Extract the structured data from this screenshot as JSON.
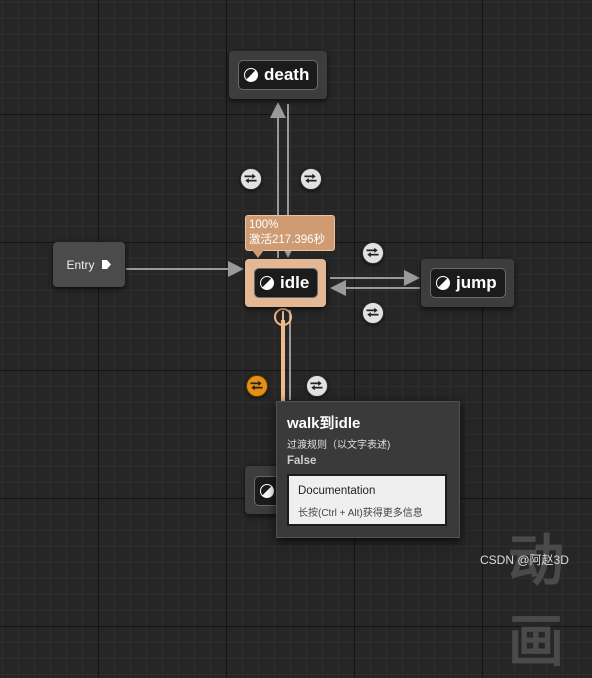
{
  "graph": {
    "entry_label": "Entry",
    "states": {
      "death": "death",
      "idle": "idle",
      "jump": "jump"
    },
    "active_state": "idle"
  },
  "active_badge": {
    "weight": "100%",
    "activation": "激活217.396秒"
  },
  "tooltip": {
    "title": "walk到idle",
    "subtitle": "过渡规则（以文字表述)",
    "value": "False",
    "doc_title": "Documentation",
    "doc_hint": "长按(Ctrl + Alt)获得更多信息"
  },
  "watermark": "CSDN @阿赵3D",
  "background_glyph": "动画",
  "colors": {
    "active_node": "#e4b894",
    "active_wire": "#f0b98c",
    "hovered_transition": "#e49112",
    "wire": "#9a9a9a"
  }
}
